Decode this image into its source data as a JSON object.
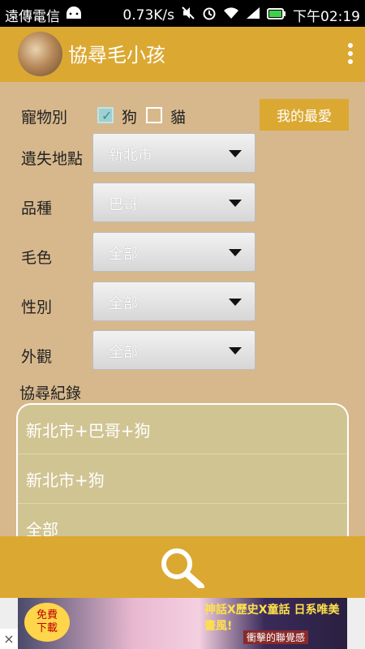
{
  "status": {
    "carrier": "遠傳電信",
    "speed": "0.73K/s",
    "time": "下午02:19"
  },
  "appbar": {
    "title": "協尋毛小孩"
  },
  "filters": {
    "pet_type_label": "寵物別",
    "dog_label": "狗",
    "cat_label": "貓",
    "dog_checked": true,
    "cat_checked": false,
    "favorites_button": "我的最愛",
    "location_label": "遺失地點",
    "location_value": "新北市",
    "breed_label": "品種",
    "breed_value": "巴哥",
    "color_label": "毛色",
    "color_value": "全部",
    "gender_label": "性別",
    "gender_value": "全部",
    "appearance_label": "外觀",
    "appearance_value": "全部"
  },
  "history": {
    "title": "協尋紀錄",
    "items": [
      "新北市+巴哥+狗",
      "新北市+狗",
      "全部"
    ]
  },
  "ad": {
    "free_line1": "免費",
    "free_line2": "下載",
    "headline": "神話X歷史X童話 日系唯美畫風!",
    "sub": "衝擊的聯覺感",
    "close": "×"
  },
  "colors": {
    "accent": "#dba832",
    "background": "#d7b88c",
    "panel": "#d1c493"
  }
}
